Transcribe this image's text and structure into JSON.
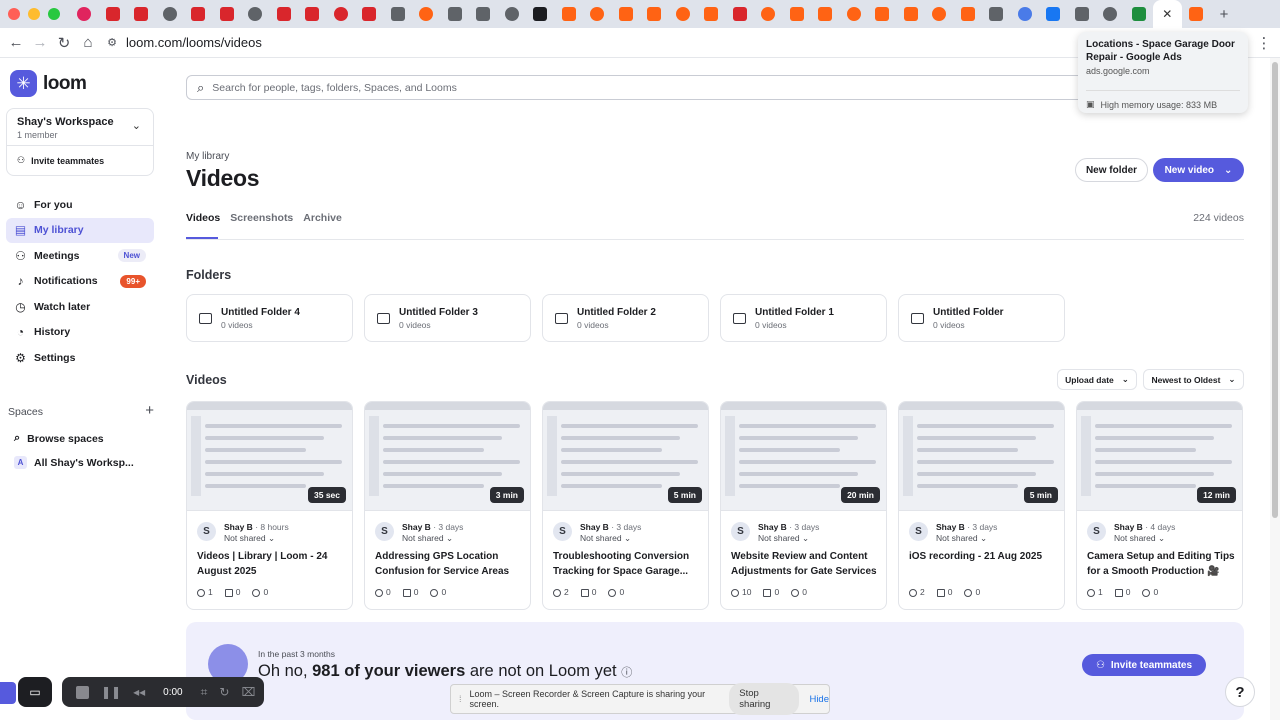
{
  "browser": {
    "url": "loom.com/looms/videos",
    "tooltip": {
      "title": "Locations - Space Garage Door Repair - Google Ads",
      "host": "ads.google.com",
      "memory": "High memory usage: 833 MB"
    }
  },
  "sidebar": {
    "logo": "loom",
    "workspace": {
      "name": "Shay's Workspace",
      "members": "1 member",
      "invite": "Invite teammates"
    },
    "nav": [
      {
        "label": "For you",
        "icon": "user-circle-icon"
      },
      {
        "label": "My library",
        "icon": "library-icon",
        "selected": true
      },
      {
        "label": "Meetings",
        "icon": "people-icon",
        "badge": "New"
      },
      {
        "label": "Notifications",
        "icon": "bell-icon",
        "badge": "99+"
      },
      {
        "label": "Watch later",
        "icon": "clock-icon"
      },
      {
        "label": "History",
        "icon": "history-icon"
      },
      {
        "label": "Settings",
        "icon": "gear-icon"
      }
    ],
    "spaces_title": "Spaces",
    "spaces": [
      {
        "label": "Browse spaces",
        "icon": "search-icon"
      },
      {
        "label": "All Shay's Worksp...",
        "icon": "A"
      }
    ]
  },
  "main": {
    "search_placeholder": "Search for people, tags, folders, Spaces, and Looms",
    "breadcrumb": "My library",
    "title": "Videos",
    "new_folder": "New folder",
    "new_video": "New video",
    "tabs": [
      "Videos",
      "Screenshots",
      "Archive"
    ],
    "video_count": "224 videos",
    "folders_title": "Folders",
    "folders": [
      {
        "name": "Untitled Folder 4",
        "count": "0 videos"
      },
      {
        "name": "Untitled Folder 3",
        "count": "0 videos"
      },
      {
        "name": "Untitled Folder 2",
        "count": "0 videos"
      },
      {
        "name": "Untitled Folder 1",
        "count": "0 videos"
      },
      {
        "name": "Untitled Folder",
        "count": "0 videos"
      }
    ],
    "videos_title": "Videos",
    "sort_field": "Upload date",
    "sort_order": "Newest to Oldest",
    "videos": [
      {
        "duration": "35 sec",
        "owner": "Shay B",
        "age": "8 hours",
        "sharing": "Not shared",
        "title": "Videos | Library | Loom - 24 August 2025",
        "views": "1",
        "comments": "0",
        "reactions": "0"
      },
      {
        "duration": "3 min",
        "owner": "Shay B",
        "age": "3 days",
        "sharing": "Not shared",
        "title": "Addressing GPS Location Confusion for Service Areas",
        "views": "0",
        "comments": "0",
        "reactions": "0"
      },
      {
        "duration": "5 min",
        "owner": "Shay B",
        "age": "3 days",
        "sharing": "Not shared",
        "title": "Troubleshooting Conversion Tracking for Space Garage...",
        "views": "2",
        "comments": "0",
        "reactions": "0"
      },
      {
        "duration": "20 min",
        "owner": "Shay B",
        "age": "3 days",
        "sharing": "Not shared",
        "title": "Website Review and Content Adjustments for Gate Services",
        "views": "10",
        "comments": "0",
        "reactions": "0"
      },
      {
        "duration": "5 min",
        "owner": "Shay B",
        "age": "3 days",
        "sharing": "Not shared",
        "title": "iOS recording - 21 Aug 2025",
        "views": "2",
        "comments": "0",
        "reactions": "0"
      },
      {
        "duration": "12 min",
        "owner": "Shay B",
        "age": "4 days",
        "sharing": "Not shared",
        "title": "Camera Setup and Editing Tips for a Smooth Production 🎥",
        "views": "1",
        "comments": "0",
        "reactions": "0"
      }
    ],
    "banner": {
      "subtitle": "In the past 3 months",
      "msg_pre": "Oh no, ",
      "msg_bold": "981 of your viewers",
      "msg_post": " are not on Loom yet",
      "button": "Invite teammates"
    }
  },
  "recorder": {
    "time": "0:00"
  },
  "share_bar": {
    "text": "Loom – Screen Recorder & Screen Capture is sharing your screen.",
    "stop": "Stop sharing",
    "hide": "Hide"
  },
  "help": "?",
  "colors": {
    "accent": "#565add",
    "badge_red": "#e8542c"
  }
}
